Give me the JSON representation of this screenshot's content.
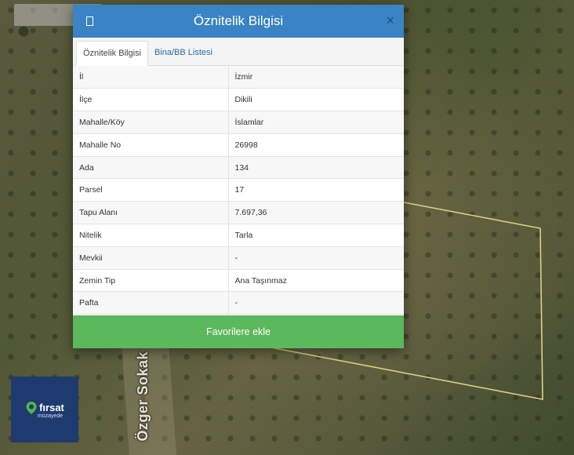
{
  "map": {
    "street_label": "Özger Sokak"
  },
  "logo": {
    "name": "fırsat",
    "sub": "müzayede"
  },
  "modal": {
    "title": "Öznitelik Bilgisi",
    "close_label": "×",
    "tabs": [
      {
        "label": "Öznitelik Bilgisi",
        "active": true
      },
      {
        "label": "Bina/BB Listesi",
        "active": false
      }
    ],
    "rows": [
      {
        "key": "İl",
        "value": "İzmir"
      },
      {
        "key": "İlçe",
        "value": "Dikili"
      },
      {
        "key": "Mahalle/Köy",
        "value": "İslamlar"
      },
      {
        "key": "Mahalle No",
        "value": "26998"
      },
      {
        "key": "Ada",
        "value": "134"
      },
      {
        "key": "Parsel",
        "value": "17"
      },
      {
        "key": "Tapu Alanı",
        "value": "7.697,36"
      },
      {
        "key": "Nitelik",
        "value": "Tarla"
      },
      {
        "key": "Mevkii",
        "value": "-"
      },
      {
        "key": "Zemin Tip",
        "value": "Ana Taşınmaz"
      },
      {
        "key": "Pafta",
        "value": "-"
      }
    ],
    "favorite_label": "Favorilere ekle"
  },
  "colors": {
    "header": "#3a83c4",
    "favorite_button": "#5cb85c",
    "logo_bg": "#1e3a6e",
    "parcel_outline": "#d9cf86"
  }
}
